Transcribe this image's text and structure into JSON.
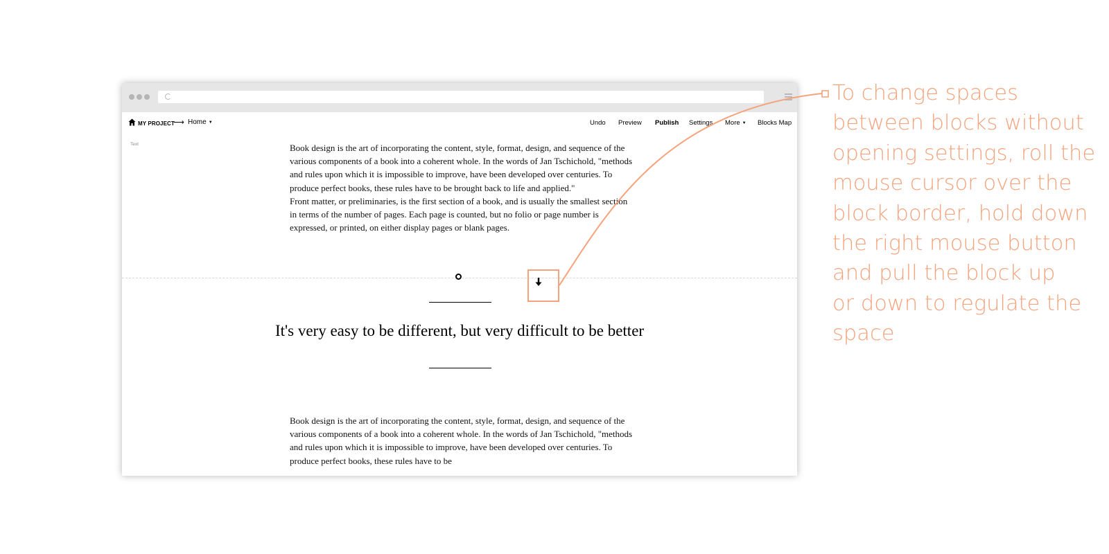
{
  "browser": {
    "window_controls": [
      "dot",
      "dot",
      "dot"
    ],
    "icons": {
      "reload": "reload-icon",
      "menu": "hamburger-icon"
    }
  },
  "toolbar": {
    "home_icon": "home-icon",
    "project_name": "MY PROJECT",
    "breadcrumb_separator": "⟶",
    "page_name": "Home",
    "menu": {
      "undo": "Undo",
      "preview": "Preview",
      "publish": "Publish",
      "settings": "Settings",
      "more": "More",
      "blocks_map": "Blocks Map"
    }
  },
  "content": {
    "block_label": "Text",
    "paragraph1": "Book design is the art of incorporating the content, style, format, design, and sequence of the various components of a book into a coherent whole. In the words of Jan Tschichold, \"methods and rules upon which it is impossible to improve, have been developed over centuries. To produce perfect books, these rules have to be brought back to life and applied.\"",
    "paragraph2": "Front matter, or preliminaries, is the first section of a book, and is usually the smallest section in terms of the number of pages. Each page is counted, but no folio or page number is expressed, or printed, on either display pages or blank pages.",
    "quote": "It's very easy to be different, but very difficult to be better",
    "paragraph3": "Book design is the art of incorporating the content, style, format, design, and sequence of the various components of a book into a coherent whole. In the words of Jan Tschichold, \"methods and rules upon which it is impossible to improve, have been developed over centuries. To produce perfect books, these rules have to be"
  },
  "controls": {
    "settings_dot_icon": "circle-icon",
    "drag_icon": "arrow-down-icon"
  },
  "callout": {
    "text": "To change spaces\nbetween blocks without\nopening settings, roll the\nmouse cursor over the\nblock border, hold down\nthe right mouse button\nand pull the block up\nor down to regulate the\nspace"
  },
  "colors": {
    "accent": "#f4a37d",
    "chrome": "#e6e6e6"
  }
}
